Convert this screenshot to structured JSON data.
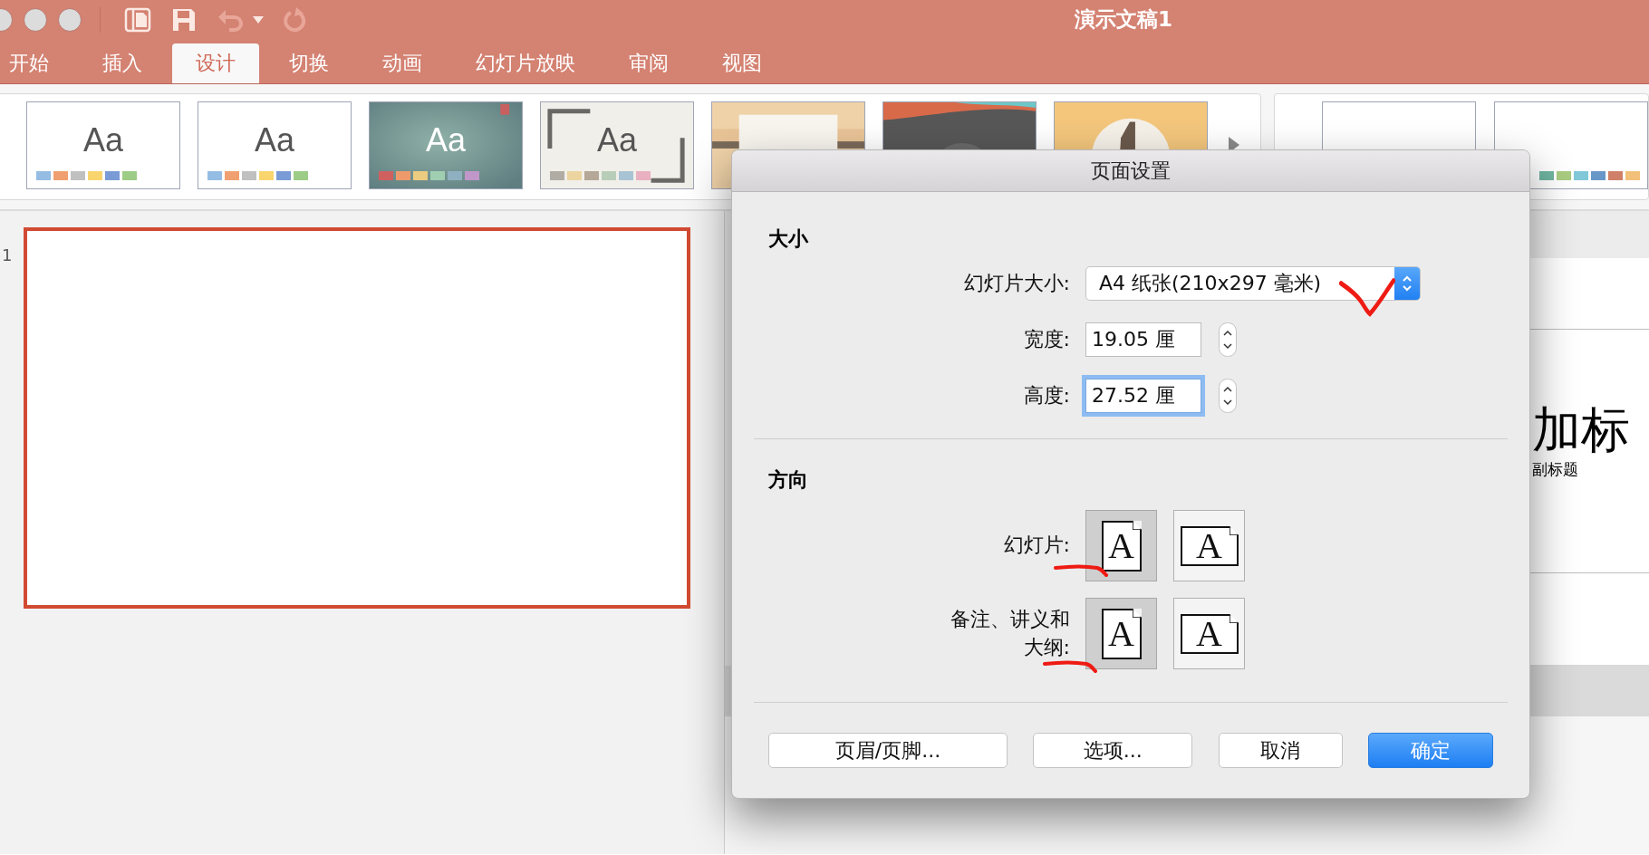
{
  "window": {
    "title": "演示文稿1"
  },
  "quick_access": [
    {
      "kind": "panel",
      "disabled": false
    },
    {
      "kind": "save",
      "disabled": false
    },
    {
      "kind": "undo",
      "disabled": true
    },
    {
      "kind": "menu",
      "disabled": false
    },
    {
      "kind": "redo",
      "disabled": true
    }
  ],
  "tabs": [
    {
      "label": "开始",
      "selected": false
    },
    {
      "label": "插入",
      "selected": false
    },
    {
      "label": "设计",
      "selected": true
    },
    {
      "label": "切换",
      "selected": false
    },
    {
      "label": "动画",
      "selected": false
    },
    {
      "label": "幻灯片放映",
      "selected": false
    },
    {
      "label": "审阅",
      "selected": false
    },
    {
      "label": "视图",
      "selected": false
    }
  ],
  "themes": [
    {
      "kind": "plain",
      "label": "Aa",
      "swatches": [
        {
          "color": "#95bde3"
        },
        {
          "color": "#f0a070"
        },
        {
          "color": "#c0c0c0"
        },
        {
          "color": "#f9d56e"
        },
        {
          "color": "#7b9bd6"
        },
        {
          "color": "#9ccc86"
        }
      ]
    },
    {
      "kind": "plain",
      "label": "Aa",
      "swatches": [
        {
          "color": "#95bde3"
        },
        {
          "color": "#f0a070"
        },
        {
          "color": "#c0c0c0"
        },
        {
          "color": "#f9d56e"
        },
        {
          "color": "#7b9bd6"
        },
        {
          "color": "#9ccc86"
        }
      ]
    },
    {
      "kind": "teal",
      "label": "Aa",
      "swatches": [
        {
          "color": "#d06060"
        },
        {
          "color": "#ee9a6a"
        },
        {
          "color": "#eccc80"
        },
        {
          "color": "#9fceb0"
        },
        {
          "color": "#8fb0c0"
        },
        {
          "color": "#c097c8"
        }
      ]
    },
    {
      "kind": "frame",
      "label": "Aa",
      "swatches": [
        {
          "color": "#b0aca4"
        },
        {
          "color": "#ecd4a0"
        },
        {
          "color": "#b5a898"
        },
        {
          "color": "#b8cdb8"
        },
        {
          "color": "#a8c4d4"
        },
        {
          "color": "#e8b0c0"
        }
      ]
    },
    {
      "kind": "wood"
    },
    {
      "kind": "dark"
    },
    {
      "kind": "badge"
    }
  ],
  "variants": [
    {
      "kind": "blank"
    },
    {
      "kind": "swatches",
      "swatches": [
        {
          "color": "#6fb5a0"
        },
        {
          "color": "#a8cc80"
        },
        {
          "color": "#80c8d8"
        },
        {
          "color": "#6898c8"
        },
        {
          "color": "#d08068"
        },
        {
          "color": "#f2c078"
        }
      ]
    }
  ],
  "slides": [
    {
      "number": "1",
      "selected": true
    }
  ],
  "editor": {
    "title": "加标",
    "subtitle": "副标题"
  },
  "dialog": {
    "title": "页面设置",
    "size": {
      "heading": "大小",
      "slide_size_label": "幻灯片大小:",
      "slide_size": "A4 纸张(210x297 毫米)",
      "width_label": "宽度:",
      "width": "19.05 厘",
      "height_label": "高度:",
      "height": "27.52 厘",
      "height_focused": true
    },
    "orientation": {
      "heading": "方向",
      "rows": [
        {
          "label": "幻灯片:",
          "options": [
            {
              "glyph": "A",
              "kind": "portrait",
              "selected": true
            },
            {
              "glyph": "A",
              "kind": "landscape",
              "selected": false
            }
          ]
        },
        {
          "label": "备注、讲义和大纲:",
          "options": [
            {
              "glyph": "A",
              "kind": "portrait",
              "selected": true
            },
            {
              "glyph": "A",
              "kind": "landscape",
              "selected": false
            }
          ]
        }
      ]
    },
    "buttons": [
      {
        "label": "页眉/页脚...",
        "default": false
      },
      {
        "label": "选项...",
        "default": false
      },
      {
        "label": "取消",
        "default": false
      },
      {
        "label": "确定",
        "default": true
      }
    ]
  },
  "annotations": [
    {
      "kind": "check"
    },
    {
      "kind": "underline"
    },
    {
      "kind": "underline"
    }
  ]
}
